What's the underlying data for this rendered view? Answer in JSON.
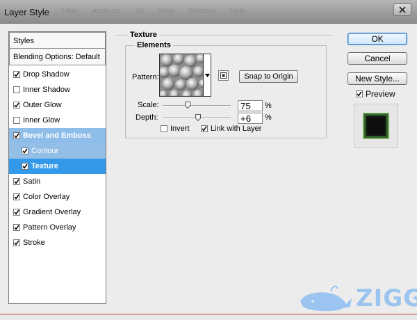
{
  "window": {
    "title": "Layer Style",
    "ghost_menu": [
      "Filter",
      "Analysis",
      "3D",
      "View",
      "Window",
      "Help"
    ]
  },
  "styles_panel": {
    "header": "Styles",
    "blending": "Blending Options: Default",
    "items": [
      {
        "label": "Drop Shadow",
        "checked": true
      },
      {
        "label": "Inner Shadow",
        "checked": false
      },
      {
        "label": "Outer Glow",
        "checked": true
      },
      {
        "label": "Inner Glow",
        "checked": false
      },
      {
        "label": "Bevel and Emboss",
        "checked": true
      },
      {
        "label": "Contour",
        "checked": true
      },
      {
        "label": "Texture",
        "checked": true
      },
      {
        "label": "Satin",
        "checked": true
      },
      {
        "label": "Color Overlay",
        "checked": true
      },
      {
        "label": "Gradient Overlay",
        "checked": true
      },
      {
        "label": "Pattern Overlay",
        "checked": true
      },
      {
        "label": "Stroke",
        "checked": true
      }
    ]
  },
  "texture": {
    "section_title": "Texture",
    "elements_title": "Elements",
    "pattern_label": "Pattern:",
    "snap_label": "Snap to Origin",
    "scale_label": "Scale:",
    "scale_value": "75",
    "scale_unit": "%",
    "depth_label": "Depth:",
    "depth_value": "+6",
    "depth_unit": "%",
    "invert_label": "Invert",
    "invert_checked": false,
    "link_label": "Link with Layer",
    "link_checked": true
  },
  "buttons": {
    "ok": "OK",
    "cancel": "Cancel",
    "new_style": "New Style...",
    "preview_label": "Preview",
    "preview_checked": true
  },
  "watermark": {
    "text": "ZIGG"
  },
  "colors": {
    "selection_strong": "#3399ea",
    "selection_light": "#8dbde8",
    "watermark": "#9bc4f0"
  }
}
